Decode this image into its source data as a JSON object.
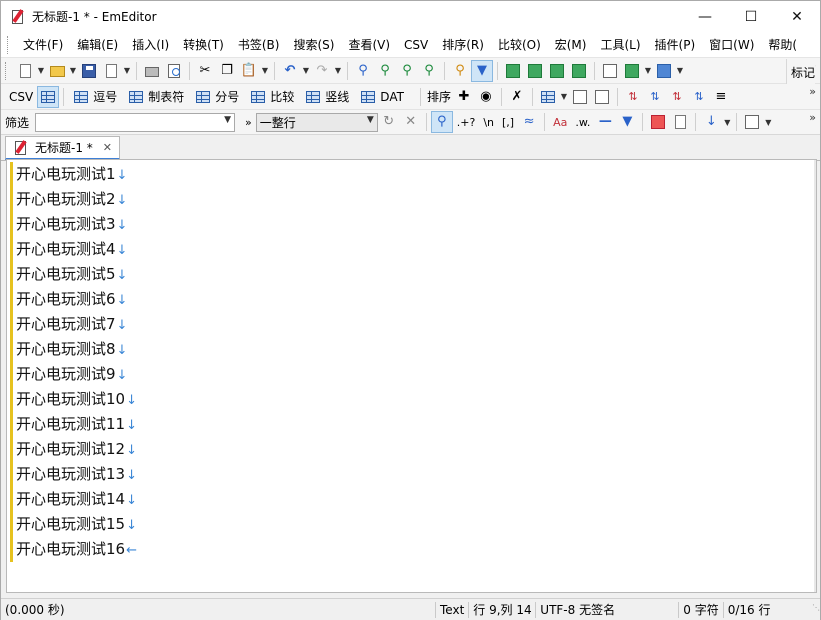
{
  "window": {
    "title": "无标题-1 * - EmEditor"
  },
  "menu": [
    "文件(F)",
    "编辑(E)",
    "插入(I)",
    "转换(T)",
    "书签(B)",
    "搜索(S)",
    "查看(V)",
    "CSV",
    "排序(R)",
    "比较(O)",
    "宏(M)",
    "工具(L)",
    "插件(P)",
    "窗口(W)",
    "帮助("
  ],
  "toolbar": {
    "marker_label": "标记"
  },
  "csv_toolbar": {
    "csv_label": "CSV",
    "buttons": [
      "逗号",
      "制表符",
      "分号",
      "比较",
      "竖线",
      "DAT"
    ],
    "sort_label": "排序"
  },
  "filter": {
    "label": "筛选",
    "value": "",
    "mode": "一整行",
    "regex_label": ".+?",
    "newline_label": "\\n",
    "bracket_label": "[,]",
    "case_label": "Aa",
    "word_label": ".w."
  },
  "tab": {
    "label": "无标题-1 *"
  },
  "editor": {
    "lines": [
      "开心电玩测试1",
      "开心电玩测试2",
      "开心电玩测试3",
      "开心电玩测试4",
      "开心电玩测试5",
      "开心电玩测试6",
      "开心电玩测试7",
      "开心电玩测试8",
      "开心电玩测试9",
      "开心电玩测试10",
      "开心电玩测试11",
      "开心电玩测试12",
      "开心电玩测试13",
      "开心电玩测试14",
      "开心电玩测试15",
      "开心电玩测试16"
    ],
    "newline_glyph": "↓",
    "eof_glyph": "←"
  },
  "status": {
    "time": "(0.000 秒)",
    "mode": "Text",
    "position": "行 9,列 14",
    "encoding": "UTF-8 无签名",
    "chars": "0 字符",
    "lines": "0/16 行"
  },
  "colors": {
    "accent": "#3d7fd6",
    "bookmark_bar": "#e6c21f",
    "newline": "#3a86d6"
  }
}
